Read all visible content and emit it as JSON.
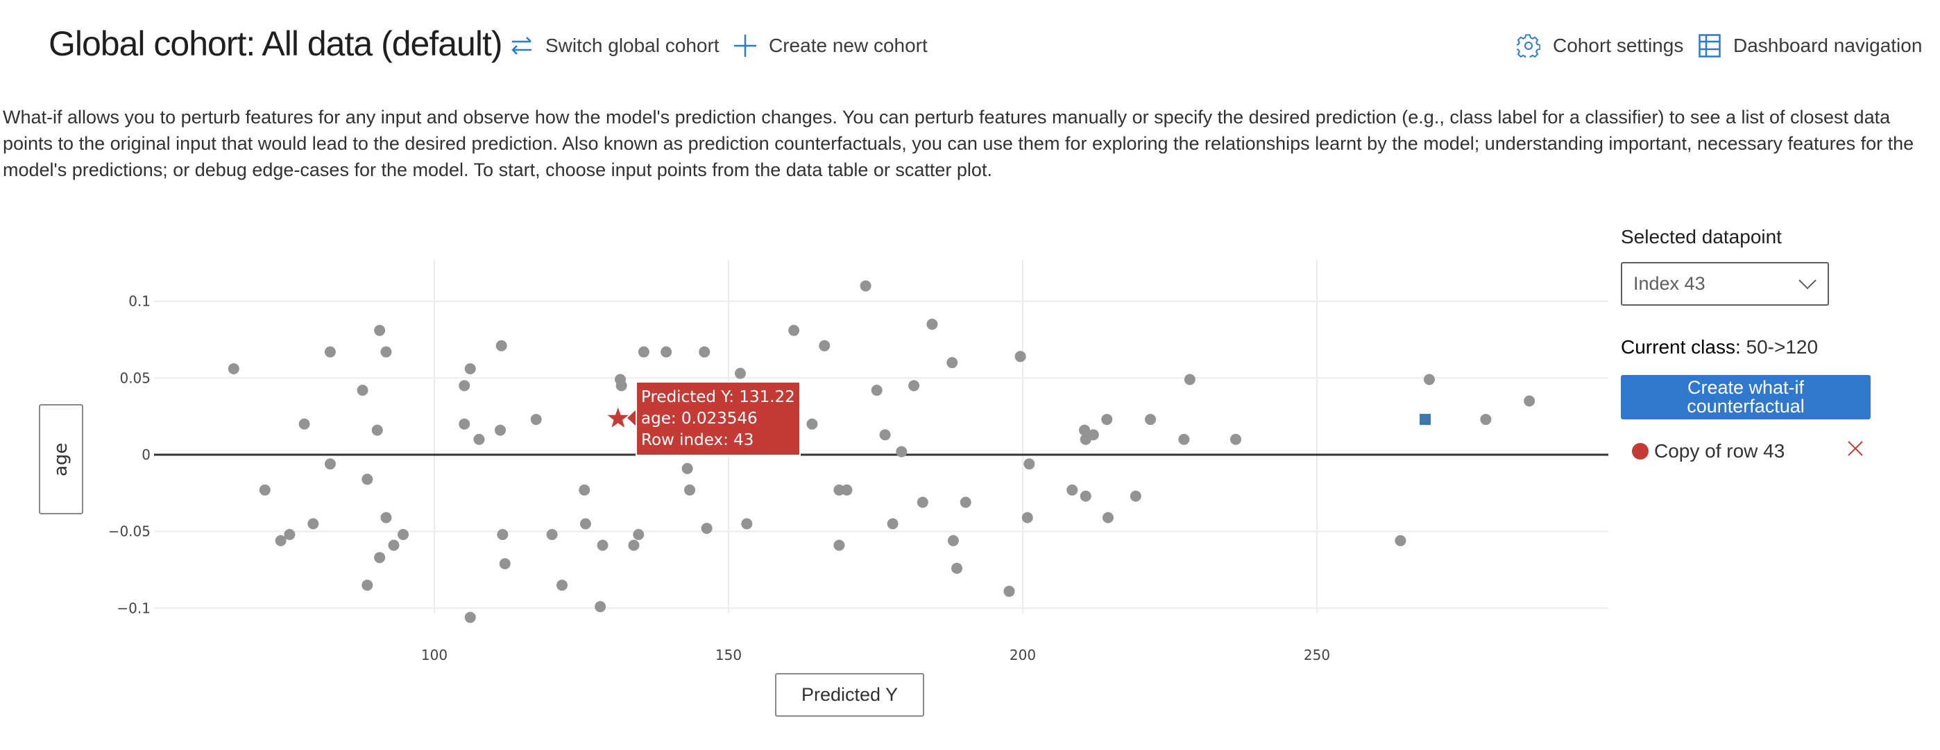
{
  "header": {
    "title": "Global cohort: All data (default)",
    "switch_cohort_label": "Switch global cohort",
    "create_cohort_label": "Create new cohort",
    "cohort_settings_label": "Cohort settings",
    "dashboard_navigation_label": "Dashboard navigation",
    "icons": {
      "switch": "switch-arrows-icon",
      "create": "plus-icon",
      "settings": "gear-icon",
      "navigation": "table-grid-icon"
    }
  },
  "description": "What-if allows you to perturb features for any input and observe how the model's prediction changes. You can perturb features manually or specify the desired prediction (e.g., class label for a classifier) to see a list of closest data points to the original input that would lead to the desired prediction. Also known as prediction counterfactuals, you can use them for exploring the relationships learnt by the model; understanding important, necessary features for the model's predictions; or debug edge-cases for the model. To start, choose input points from the data table or scatter plot.",
  "axes": {
    "y_button_label": "age",
    "x_button_label": "Predicted Y"
  },
  "tooltip": {
    "line1": "Predicted Y: 131.22",
    "line2": "age: 0.023546",
    "line3": "Row index: 43"
  },
  "panel": {
    "selected_label": "Selected datapoint",
    "selected_value": "Index 43",
    "current_class_label": "Current class:",
    "current_class_value": "50->120",
    "create_button_label": "Create what-if counterfactual",
    "copy_item_label": "Copy of row 43"
  },
  "colors": {
    "accent": "#3078cd",
    "selected": "#c33b34",
    "point": "#939393",
    "counterfactual": "#3c77b0"
  },
  "chart_data": {
    "type": "scatter",
    "title": "",
    "xlabel": "Predicted Y",
    "ylabel": "age",
    "xlim": [
      52.4,
      299
    ],
    "ylim": [
      -0.118,
      0.125
    ],
    "x_ticks": [
      100,
      150,
      200,
      250
    ],
    "x_tick_labels": [
      "100",
      "150",
      "200",
      "250"
    ],
    "y_ticks": [
      0.1,
      0.05,
      0,
      -0.05,
      -0.1
    ],
    "y_tick_labels": [
      "0.1",
      "0.05",
      "0",
      "−0.05",
      "−0.1"
    ],
    "grid": true,
    "points": [
      [
        65.9,
        0.056
      ],
      [
        71.2,
        -0.023
      ],
      [
        73.9,
        -0.056
      ],
      [
        75.4,
        -0.052
      ],
      [
        77.9,
        0.02
      ],
      [
        79.4,
        -0.045
      ],
      [
        82.3,
        0.067
      ],
      [
        82.3,
        -0.006
      ],
      [
        87.8,
        0.042
      ],
      [
        88.6,
        -0.016
      ],
      [
        88.6,
        -0.085
      ],
      [
        90.7,
        0.081
      ],
      [
        90.3,
        0.016
      ],
      [
        90.7,
        -0.067
      ],
      [
        91.8,
        0.067
      ],
      [
        91.8,
        -0.041
      ],
      [
        93.1,
        -0.059
      ],
      [
        94.7,
        -0.052
      ],
      [
        105.1,
        0.045
      ],
      [
        105.1,
        0.02
      ],
      [
        106.1,
        0.056
      ],
      [
        106.1,
        -0.106
      ],
      [
        107.6,
        0.01
      ],
      [
        111.4,
        0.071
      ],
      [
        111.2,
        0.016
      ],
      [
        111.6,
        -0.052
      ],
      [
        112.0,
        -0.071
      ],
      [
        117.3,
        0.023
      ],
      [
        120.0,
        -0.052
      ],
      [
        121.7,
        -0.085
      ],
      [
        125.5,
        -0.023
      ],
      [
        125.7,
        -0.045
      ],
      [
        128.2,
        -0.099
      ],
      [
        128.6,
        -0.059
      ],
      [
        131.6,
        0.049
      ],
      [
        131.8,
        0.045
      ],
      [
        133.9,
        -0.059
      ],
      [
        134.7,
        -0.052
      ],
      [
        135.6,
        0.067
      ],
      [
        139.4,
        0.067
      ],
      [
        143.0,
        -0.009
      ],
      [
        143.4,
        -0.023
      ],
      [
        145.9,
        0.067
      ],
      [
        146.3,
        -0.048
      ],
      [
        152.0,
        0.053
      ],
      [
        153.1,
        -0.045
      ],
      [
        161.1,
        0.081
      ],
      [
        164.2,
        0.02
      ],
      [
        166.3,
        0.071
      ],
      [
        168.8,
        -0.023
      ],
      [
        168.8,
        -0.059
      ],
      [
        170.1,
        -0.023
      ],
      [
        173.3,
        0.11
      ],
      [
        175.2,
        0.042
      ],
      [
        176.6,
        0.013
      ],
      [
        177.9,
        -0.045
      ],
      [
        179.4,
        0.002
      ],
      [
        181.5,
        0.045
      ],
      [
        183.0,
        -0.031
      ],
      [
        184.6,
        0.085
      ],
      [
        188.0,
        0.06
      ],
      [
        188.2,
        -0.056
      ],
      [
        188.8,
        -0.074
      ],
      [
        190.3,
        -0.031
      ],
      [
        197.7,
        -0.089
      ],
      [
        199.6,
        0.064
      ],
      [
        200.8,
        -0.041
      ],
      [
        201.1,
        -0.006
      ],
      [
        208.4,
        -0.023
      ],
      [
        210.5,
        0.016
      ],
      [
        210.7,
        -0.027
      ],
      [
        210.7,
        0.01
      ],
      [
        212.0,
        0.013
      ],
      [
        214.3,
        0.023
      ],
      [
        214.5,
        -0.041
      ],
      [
        219.2,
        -0.027
      ],
      [
        221.7,
        0.023
      ],
      [
        227.4,
        0.01
      ],
      [
        228.4,
        0.049
      ],
      [
        236.2,
        0.01
      ],
      [
        264.2,
        -0.056
      ],
      [
        269.1,
        0.049
      ],
      [
        278.7,
        0.023
      ],
      [
        286.1,
        0.035
      ]
    ],
    "selected_point": {
      "x": 131.22,
      "y": 0.023546,
      "row_index": 43,
      "marker": "star"
    },
    "counterfactual_point": {
      "x": 268.4,
      "y": 0.023,
      "marker": "square"
    }
  }
}
